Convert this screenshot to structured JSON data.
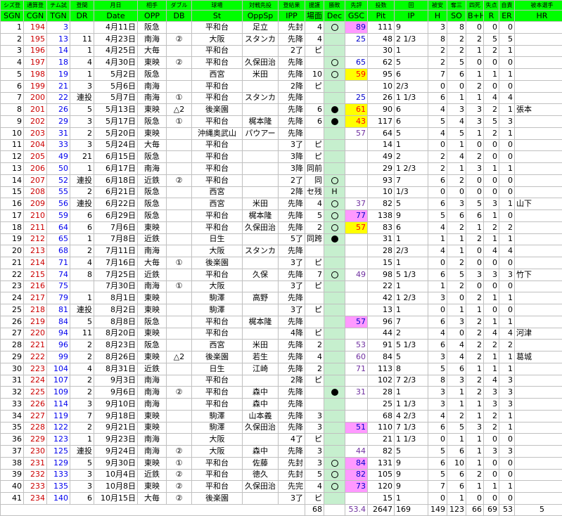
{
  "headers": {
    "jp": [
      "シズ登",
      "通算登",
      "チム試",
      "登間",
      "月日",
      "相手",
      "ダブル",
      "球場",
      "対戦先投",
      "登結果",
      "援護",
      "勝敗",
      "先評",
      "投数",
      "回",
      "被安",
      "奪三",
      "四死",
      "失点",
      "自責",
      "被本選手"
    ],
    "en": [
      "SGN",
      "CGN",
      "TGN",
      "DR",
      "Date",
      "OPP",
      "DB",
      "St",
      "OppSp",
      "IPP",
      "場面",
      "Dec",
      "GSC",
      "Pit",
      "IP",
      "H",
      "SO",
      "B+H",
      "R",
      "ER",
      "HR"
    ]
  },
  "rows": [
    {
      "sgn": "1",
      "cgn": "194",
      "tgn": "3",
      "dr": "",
      "date": "4月11日",
      "opp": "阪急",
      "db": "",
      "st": "平和台",
      "oppsp": "足立",
      "ipp": "先封",
      "ba": "4",
      "dec": "o",
      "gsc": "89",
      "gsc_bg": "p",
      "gsc_col": "blue",
      "pit": "111",
      "ip": "9",
      "h": "3",
      "so": "8",
      "bh": "0",
      "r": "0",
      "er": "0",
      "hr": ""
    },
    {
      "sgn": "2",
      "cgn": "195",
      "tgn": "13",
      "dr": "11",
      "date": "4月23日",
      "opp": "南海",
      "db": "②",
      "st": "大阪",
      "oppsp": "スタンカ",
      "ipp": "先降",
      "ba": "4",
      "dec": "",
      "gsc": "25",
      "gsc_bg": "",
      "gsc_col": "blue",
      "pit": "48",
      "ip": "2 1/3",
      "h": "8",
      "so": "2",
      "bh": "2",
      "r": "5",
      "er": "5",
      "hr": ""
    },
    {
      "sgn": "3",
      "cgn": "196",
      "tgn": "14",
      "dr": "1",
      "date": "4月25日",
      "opp": "大毎",
      "db": "",
      "st": "平和台",
      "oppsp": "",
      "ipp": "2了",
      "ba": "ピ",
      "dec": "",
      "gsc": "",
      "gsc_bg": "",
      "gsc_col": "",
      "pit": "30",
      "ip": "1",
      "h": "2",
      "so": "2",
      "bh": "1",
      "r": "2",
      "er": "1",
      "hr": ""
    },
    {
      "sgn": "4",
      "cgn": "197",
      "tgn": "18",
      "dr": "4",
      "date": "4月30日",
      "opp": "東映",
      "db": "②",
      "st": "平和台",
      "oppsp": "久保田治",
      "ipp": "先降",
      "ba": "",
      "dec": "o",
      "gsc": "65",
      "gsc_bg": "",
      "gsc_col": "blue",
      "pit": "62",
      "ip": "5",
      "h": "2",
      "so": "5",
      "bh": "0",
      "r": "0",
      "er": "0",
      "hr": ""
    },
    {
      "sgn": "5",
      "cgn": "198",
      "tgn": "19",
      "dr": "1",
      "date": "5月2日",
      "opp": "阪急",
      "db": "",
      "st": "西宮",
      "oppsp": "米田",
      "ipp": "先降",
      "ba": "10",
      "dec": "o",
      "gsc": "59",
      "gsc_bg": "y",
      "gsc_col": "red",
      "pit": "95",
      "ip": "6",
      "h": "7",
      "so": "6",
      "bh": "1",
      "r": "1",
      "er": "1",
      "hr": ""
    },
    {
      "sgn": "6",
      "cgn": "199",
      "tgn": "21",
      "dr": "3",
      "date": "5月6日",
      "opp": "南海",
      "db": "",
      "st": "平和台",
      "oppsp": "",
      "ipp": "2降",
      "ba": "ピ",
      "dec": "",
      "gsc": "",
      "gsc_bg": "",
      "gsc_col": "",
      "pit": "10",
      "ip": "2/3",
      "h": "0",
      "so": "0",
      "bh": "2",
      "r": "0",
      "er": "0",
      "hr": ""
    },
    {
      "sgn": "7",
      "cgn": "200",
      "tgn": "22",
      "dr": "連投",
      "date": "5月7日",
      "opp": "南海",
      "db": "①",
      "st": "平和台",
      "oppsp": "スタンカ",
      "ipp": "先降",
      "ba": "",
      "dec": "",
      "gsc": "25",
      "gsc_bg": "",
      "gsc_col": "blue",
      "pit": "26",
      "ip": "1 1/3",
      "h": "6",
      "so": "1",
      "bh": "1",
      "r": "4",
      "er": "4",
      "hr": ""
    },
    {
      "sgn": "8",
      "cgn": "201",
      "tgn": "26",
      "dr": "5",
      "date": "5月13日",
      "opp": "東映",
      "db": "△2",
      "st": "後楽園",
      "oppsp": "",
      "ipp": "先降",
      "ba": "6",
      "dec": "b",
      "gsc": "61",
      "gsc_bg": "y",
      "gsc_col": "red",
      "pit": "90",
      "ip": "6",
      "h": "4",
      "so": "3",
      "bh": "3",
      "r": "2",
      "er": "1",
      "hr": "張本"
    },
    {
      "sgn": "9",
      "cgn": "202",
      "tgn": "29",
      "dr": "3",
      "date": "5月17日",
      "opp": "阪急",
      "db": "①",
      "st": "平和台",
      "oppsp": "梶本隆",
      "ipp": "先降",
      "ba": "6",
      "dec": "b",
      "gsc": "43",
      "gsc_bg": "y",
      "gsc_col": "red",
      "pit": "117",
      "ip": "6",
      "h": "5",
      "so": "4",
      "bh": "3",
      "r": "5",
      "er": "3",
      "hr": ""
    },
    {
      "sgn": "10",
      "cgn": "203",
      "tgn": "31",
      "dr": "2",
      "date": "5月20日",
      "opp": "東映",
      "db": "",
      "st": "沖縄奥武山",
      "oppsp": "パウアー",
      "ipp": "先降",
      "ba": "",
      "dec": "",
      "gsc": "57",
      "gsc_bg": "",
      "gsc_col": "purple",
      "pit": "64",
      "ip": "5",
      "h": "4",
      "so": "5",
      "bh": "1",
      "r": "2",
      "er": "1",
      "hr": ""
    },
    {
      "sgn": "11",
      "cgn": "204",
      "tgn": "33",
      "dr": "3",
      "date": "5月24日",
      "opp": "大毎",
      "db": "",
      "st": "平和台",
      "oppsp": "",
      "ipp": "3了",
      "ba": "ピ",
      "dec": "",
      "gsc": "",
      "gsc_bg": "",
      "gsc_col": "",
      "pit": "14",
      "ip": "1",
      "h": "0",
      "so": "1",
      "bh": "0",
      "r": "0",
      "er": "0",
      "hr": ""
    },
    {
      "sgn": "12",
      "cgn": "205",
      "tgn": "49",
      "dr": "21",
      "date": "6月15日",
      "opp": "阪急",
      "db": "",
      "st": "平和台",
      "oppsp": "",
      "ipp": "3降",
      "ba": "ピ",
      "dec": "",
      "gsc": "",
      "gsc_bg": "",
      "gsc_col": "",
      "pit": "49",
      "ip": "2",
      "h": "2",
      "so": "4",
      "bh": "2",
      "r": "0",
      "er": "0",
      "hr": ""
    },
    {
      "sgn": "13",
      "cgn": "206",
      "tgn": "50",
      "dr": "1",
      "date": "6月17日",
      "opp": "南海",
      "db": "",
      "st": "平和台",
      "oppsp": "",
      "ipp": "3降",
      "ba": "同前",
      "dec": "",
      "gsc": "",
      "gsc_bg": "",
      "gsc_col": "",
      "pit": "29",
      "ip": "1 2/3",
      "h": "2",
      "so": "1",
      "bh": "3",
      "r": "1",
      "er": "1",
      "hr": ""
    },
    {
      "sgn": "14",
      "cgn": "207",
      "tgn": "52",
      "dr": "連投",
      "date": "6月18日",
      "opp": "近鉄",
      "db": "②",
      "st": "平和台",
      "oppsp": "",
      "ipp": "2了",
      "ba": "同",
      "dec": "o",
      "gsc": "",
      "gsc_bg": "",
      "gsc_col": "",
      "pit": "93",
      "ip": "7",
      "h": "6",
      "so": "2",
      "bh": "0",
      "r": "0",
      "er": "0",
      "hr": ""
    },
    {
      "sgn": "15",
      "cgn": "208",
      "tgn": "55",
      "dr": "2",
      "date": "6月21日",
      "opp": "阪急",
      "db": "",
      "st": "西宮",
      "oppsp": "",
      "ipp": "2降",
      "ba": "セ残",
      "dec": "H",
      "gsc": "",
      "gsc_bg": "",
      "gsc_col": "",
      "pit": "10",
      "ip": "1/3",
      "h": "0",
      "so": "0",
      "bh": "0",
      "r": "0",
      "er": "0",
      "hr": ""
    },
    {
      "sgn": "16",
      "cgn": "209",
      "tgn": "56",
      "dr": "連投",
      "date": "6月22日",
      "opp": "阪急",
      "db": "",
      "st": "西宮",
      "oppsp": "米田",
      "ipp": "先降",
      "ba": "4",
      "dec": "o",
      "gsc": "37",
      "gsc_bg": "",
      "gsc_col": "purple",
      "pit": "82",
      "ip": "5",
      "h": "6",
      "so": "3",
      "bh": "5",
      "r": "3",
      "er": "1",
      "hr": "山下"
    },
    {
      "sgn": "17",
      "cgn": "210",
      "tgn": "59",
      "dr": "6",
      "date": "6月29日",
      "opp": "阪急",
      "db": "",
      "st": "平和台",
      "oppsp": "梶本隆",
      "ipp": "先降",
      "ba": "5",
      "dec": "o",
      "gsc": "77",
      "gsc_bg": "p",
      "gsc_col": "blue",
      "pit": "138",
      "ip": "9",
      "h": "5",
      "so": "6",
      "bh": "6",
      "r": "1",
      "er": "0",
      "hr": ""
    },
    {
      "sgn": "18",
      "cgn": "211",
      "tgn": "64",
      "dr": "6",
      "date": "7月6日",
      "opp": "東映",
      "db": "",
      "st": "平和台",
      "oppsp": "久保田治",
      "ipp": "先降",
      "ba": "2",
      "dec": "o",
      "gsc": "57",
      "gsc_bg": "y",
      "gsc_col": "red",
      "pit": "83",
      "ip": "6",
      "h": "4",
      "so": "2",
      "bh": "1",
      "r": "2",
      "er": "2",
      "hr": ""
    },
    {
      "sgn": "19",
      "cgn": "212",
      "tgn": "65",
      "dr": "1",
      "date": "7月8日",
      "opp": "近鉄",
      "db": "",
      "st": "日生",
      "oppsp": "",
      "ipp": "5了",
      "ba": "同跨",
      "dec": "b",
      "gsc": "",
      "gsc_bg": "",
      "gsc_col": "",
      "pit": "31",
      "ip": "1",
      "h": "1",
      "so": "1",
      "bh": "2",
      "r": "1",
      "er": "1",
      "hr": ""
    },
    {
      "sgn": "20",
      "cgn": "213",
      "tgn": "68",
      "dr": "2",
      "date": "7月11日",
      "opp": "南海",
      "db": "",
      "st": "大阪",
      "oppsp": "スタンカ",
      "ipp": "先降",
      "ba": "",
      "dec": "",
      "gsc": "",
      "gsc_bg": "",
      "gsc_col": "",
      "pit": "28",
      "ip": "2/3",
      "h": "4",
      "so": "1",
      "bh": "0",
      "r": "4",
      "er": "4",
      "hr": ""
    },
    {
      "sgn": "21",
      "cgn": "214",
      "tgn": "71",
      "dr": "4",
      "date": "7月16日",
      "opp": "大毎",
      "db": "①",
      "st": "後楽園",
      "oppsp": "",
      "ipp": "3了",
      "ba": "ピ",
      "dec": "",
      "gsc": "",
      "gsc_bg": "",
      "gsc_col": "",
      "pit": "15",
      "ip": "1",
      "h": "0",
      "so": "2",
      "bh": "0",
      "r": "0",
      "er": "0",
      "hr": ""
    },
    {
      "sgn": "22",
      "cgn": "215",
      "tgn": "74",
      "dr": "8",
      "date": "7月25日",
      "opp": "近鉄",
      "db": "",
      "st": "平和台",
      "oppsp": "久保",
      "ipp": "先降",
      "ba": "7",
      "dec": "o",
      "gsc": "49",
      "gsc_bg": "",
      "gsc_col": "purple",
      "pit": "98",
      "ip": "5 1/3",
      "h": "6",
      "so": "5",
      "bh": "3",
      "r": "3",
      "er": "3",
      "hr": "竹下"
    },
    {
      "sgn": "23",
      "cgn": "216",
      "tgn": "75",
      "dr": "",
      "date": "7月30日",
      "opp": "南海",
      "db": "①",
      "st": "大阪",
      "oppsp": "",
      "ipp": "3了",
      "ba": "ピ",
      "dec": "",
      "gsc": "",
      "gsc_bg": "",
      "gsc_col": "",
      "pit": "22",
      "ip": "1",
      "h": "1",
      "so": "2",
      "bh": "0",
      "r": "0",
      "er": "0",
      "hr": ""
    },
    {
      "sgn": "24",
      "cgn": "217",
      "tgn": "79",
      "dr": "1",
      "date": "8月1日",
      "opp": "東映",
      "db": "",
      "st": "駒澤",
      "oppsp": "高野",
      "ipp": "先降",
      "ba": "",
      "dec": "",
      "gsc": "",
      "gsc_bg": "",
      "gsc_col": "",
      "pit": "42",
      "ip": "1 2/3",
      "h": "3",
      "so": "0",
      "bh": "2",
      "r": "1",
      "er": "1",
      "hr": ""
    },
    {
      "sgn": "25",
      "cgn": "218",
      "tgn": "81",
      "dr": "連投",
      "date": "8月2日",
      "opp": "東映",
      "db": "",
      "st": "駒澤",
      "oppsp": "",
      "ipp": "3了",
      "ba": "ピ",
      "dec": "",
      "gsc": "",
      "gsc_bg": "",
      "gsc_col": "",
      "pit": "13",
      "ip": "1",
      "h": "0",
      "so": "1",
      "bh": "1",
      "r": "0",
      "er": "0",
      "hr": ""
    },
    {
      "sgn": "26",
      "cgn": "219",
      "tgn": "84",
      "dr": "5",
      "date": "8月8日",
      "opp": "阪急",
      "db": "",
      "st": "平和台",
      "oppsp": "梶本隆",
      "ipp": "先降",
      "ba": "",
      "dec": "",
      "gsc": "57",
      "gsc_bg": "p",
      "gsc_col": "blue",
      "pit": "96",
      "ip": "7",
      "h": "6",
      "so": "3",
      "bh": "2",
      "r": "1",
      "er": "1",
      "hr": ""
    },
    {
      "sgn": "27",
      "cgn": "220",
      "tgn": "94",
      "dr": "11",
      "date": "8月20日",
      "opp": "東映",
      "db": "",
      "st": "平和台",
      "oppsp": "",
      "ipp": "4降",
      "ba": "ピ",
      "dec": "",
      "gsc": "",
      "gsc_bg": "",
      "gsc_col": "",
      "pit": "44",
      "ip": "2",
      "h": "4",
      "so": "0",
      "bh": "2",
      "r": "4",
      "er": "4",
      "hr": "河津"
    },
    {
      "sgn": "28",
      "cgn": "221",
      "tgn": "96",
      "dr": "2",
      "date": "8月23日",
      "opp": "阪急",
      "db": "",
      "st": "西宮",
      "oppsp": "米田",
      "ipp": "先降",
      "ba": "2",
      "dec": "",
      "gsc": "53",
      "gsc_bg": "",
      "gsc_col": "purple",
      "pit": "91",
      "ip": "5 1/3",
      "h": "6",
      "so": "4",
      "bh": "2",
      "r": "2",
      "er": "2",
      "hr": ""
    },
    {
      "sgn": "29",
      "cgn": "222",
      "tgn": "99",
      "dr": "2",
      "date": "8月26日",
      "opp": "東映",
      "db": "△2",
      "st": "後楽園",
      "oppsp": "若生",
      "ipp": "先降",
      "ba": "4",
      "dec": "",
      "gsc": "60",
      "gsc_bg": "",
      "gsc_col": "purple",
      "pit": "84",
      "ip": "5",
      "h": "3",
      "so": "4",
      "bh": "2",
      "r": "1",
      "er": "1",
      "hr": "葛城"
    },
    {
      "sgn": "30",
      "cgn": "223",
      "tgn": "104",
      "dr": "4",
      "date": "8月31日",
      "opp": "近鉄",
      "db": "",
      "st": "日生",
      "oppsp": "江崎",
      "ipp": "先降",
      "ba": "2",
      "dec": "",
      "gsc": "71",
      "gsc_bg": "",
      "gsc_col": "purple",
      "pit": "113",
      "ip": "8",
      "h": "5",
      "so": "6",
      "bh": "1",
      "r": "1",
      "er": "1",
      "hr": ""
    },
    {
      "sgn": "31",
      "cgn": "224",
      "tgn": "107",
      "dr": "2",
      "date": "9月3日",
      "opp": "南海",
      "db": "",
      "st": "平和台",
      "oppsp": "",
      "ipp": "2降",
      "ba": "ピ",
      "dec": "",
      "gsc": "",
      "gsc_bg": "",
      "gsc_col": "",
      "pit": "102",
      "ip": "7 2/3",
      "h": "8",
      "so": "3",
      "bh": "2",
      "r": "4",
      "er": "3",
      "hr": ""
    },
    {
      "sgn": "32",
      "cgn": "225",
      "tgn": "109",
      "dr": "2",
      "date": "9月6日",
      "opp": "南海",
      "db": "②",
      "st": "平和台",
      "oppsp": "森中",
      "ipp": "先降",
      "ba": "",
      "dec": "b",
      "gsc": "31",
      "gsc_bg": "",
      "gsc_col": "purple",
      "pit": "28",
      "ip": "1",
      "h": "3",
      "so": "1",
      "bh": "2",
      "r": "3",
      "er": "3",
      "hr": ""
    },
    {
      "sgn": "33",
      "cgn": "226",
      "tgn": "114",
      "dr": "3",
      "date": "9月10日",
      "opp": "南海",
      "db": "",
      "st": "平和台",
      "oppsp": "森中",
      "ipp": "先降",
      "ba": "",
      "dec": "",
      "gsc": "",
      "gsc_bg": "",
      "gsc_col": "",
      "pit": "25",
      "ip": "1 1/3",
      "h": "3",
      "so": "1",
      "bh": "1",
      "r": "3",
      "er": "3",
      "hr": ""
    },
    {
      "sgn": "34",
      "cgn": "227",
      "tgn": "119",
      "dr": "7",
      "date": "9月18日",
      "opp": "東映",
      "db": "",
      "st": "駒澤",
      "oppsp": "山本義",
      "ipp": "先降",
      "ba": "3",
      "dec": "",
      "gsc": "",
      "gsc_bg": "",
      "gsc_col": "",
      "pit": "68",
      "ip": "4 2/3",
      "h": "4",
      "so": "2",
      "bh": "1",
      "r": "2",
      "er": "1",
      "hr": ""
    },
    {
      "sgn": "35",
      "cgn": "228",
      "tgn": "122",
      "dr": "2",
      "date": "9月21日",
      "opp": "東映",
      "db": "",
      "st": "駒澤",
      "oppsp": "久保田治",
      "ipp": "先降",
      "ba": "3",
      "dec": "",
      "gsc": "51",
      "gsc_bg": "p",
      "gsc_col": "blue",
      "pit": "110",
      "ip": "7 1/3",
      "h": "6",
      "so": "5",
      "bh": "3",
      "r": "2",
      "er": "1",
      "hr": ""
    },
    {
      "sgn": "36",
      "cgn": "229",
      "tgn": "123",
      "dr": "1",
      "date": "9月23日",
      "opp": "南海",
      "db": "",
      "st": "大阪",
      "oppsp": "",
      "ipp": "4了",
      "ba": "ピ",
      "dec": "",
      "gsc": "",
      "gsc_bg": "",
      "gsc_col": "",
      "pit": "21",
      "ip": "1 1/3",
      "h": "0",
      "so": "1",
      "bh": "1",
      "r": "0",
      "er": "0",
      "hr": ""
    },
    {
      "sgn": "37",
      "cgn": "230",
      "tgn": "125",
      "dr": "連投",
      "date": "9月24日",
      "opp": "南海",
      "db": "②",
      "st": "大阪",
      "oppsp": "森中",
      "ipp": "先降",
      "ba": "3",
      "dec": "",
      "gsc": "44",
      "gsc_bg": "",
      "gsc_col": "purple",
      "pit": "82",
      "ip": "5",
      "h": "5",
      "so": "6",
      "bh": "1",
      "r": "3",
      "er": "3",
      "hr": ""
    },
    {
      "sgn": "38",
      "cgn": "231",
      "tgn": "129",
      "dr": "5",
      "date": "9月30日",
      "opp": "東映",
      "db": "①",
      "st": "平和台",
      "oppsp": "佐藤",
      "ipp": "先封",
      "ba": "3",
      "dec": "o",
      "gsc": "84",
      "gsc_bg": "p",
      "gsc_col": "blue",
      "pit": "131",
      "ip": "9",
      "h": "6",
      "so": "10",
      "bh": "1",
      "r": "0",
      "er": "0",
      "hr": ""
    },
    {
      "sgn": "39",
      "cgn": "232",
      "tgn": "133",
      "dr": "3",
      "date": "10月4日",
      "opp": "近鉄",
      "db": "②",
      "st": "平和台",
      "oppsp": "徳久",
      "ipp": "先封",
      "ba": "5",
      "dec": "o",
      "gsc": "82",
      "gsc_bg": "p",
      "gsc_col": "blue",
      "pit": "105",
      "ip": "9",
      "h": "5",
      "so": "6",
      "bh": "2",
      "r": "0",
      "er": "0",
      "hr": ""
    },
    {
      "sgn": "40",
      "cgn": "233",
      "tgn": "135",
      "dr": "3",
      "date": "10月8日",
      "opp": "東映",
      "db": "②",
      "st": "平和台",
      "oppsp": "久保田治",
      "ipp": "先完",
      "ba": "4",
      "dec": "o",
      "gsc": "73",
      "gsc_bg": "p",
      "gsc_col": "blue",
      "pit": "120",
      "ip": "9",
      "h": "7",
      "so": "6",
      "bh": "1",
      "r": "1",
      "er": "1",
      "hr": ""
    },
    {
      "sgn": "41",
      "cgn": "234",
      "tgn": "140",
      "dr": "6",
      "date": "10月15日",
      "opp": "大毎",
      "db": "②",
      "st": "後楽園",
      "oppsp": "",
      "ipp": "3了",
      "ba": "ピ",
      "dec": "",
      "gsc": "",
      "gsc_bg": "",
      "gsc_col": "",
      "pit": "15",
      "ip": "1",
      "h": "0",
      "so": "1",
      "bh": "0",
      "r": "0",
      "er": "0",
      "hr": ""
    }
  ],
  "totals": {
    "ba": "68",
    "gsc": "53.4",
    "pit": "2647",
    "ip": "169",
    "h": "149",
    "so": "123",
    "bh": "66",
    "r": "69",
    "er": "53",
    "hr": "5"
  }
}
